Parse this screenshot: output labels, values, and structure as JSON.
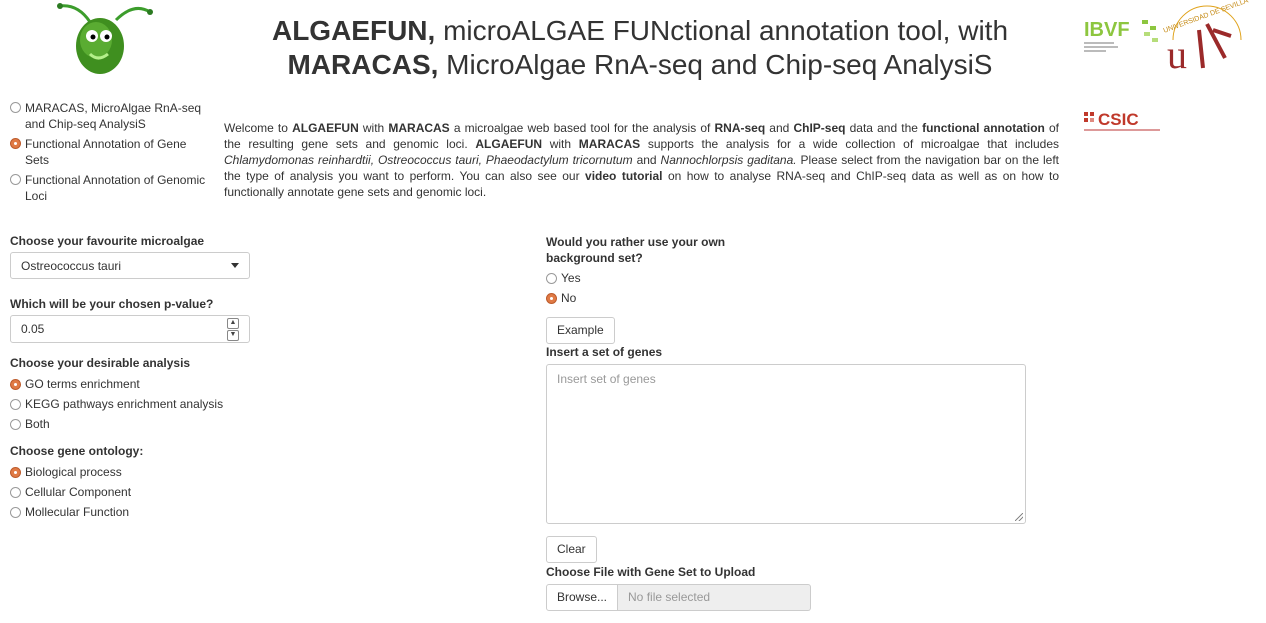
{
  "header": {
    "title_line1_bold": "ALGAEFUN,",
    "title_line1_rest": " microALGAE FUNctional annotation tool, with",
    "title_line2_bold": "MARACAS,",
    "title_line2_rest": " MicroAlgae RnA-seq and Chip-seq AnalysiS",
    "ibvf_logo": "IBVF",
    "us_logo": "UNIVERSIDAD DE SEVILLA",
    "csic_logo": "CSIC"
  },
  "nav": {
    "items": [
      {
        "label": "MARACAS, MicroAlgae RnA-seq and Chip-seq AnalysiS",
        "selected": false
      },
      {
        "label": "Functional Annotation of Gene Sets",
        "selected": true
      },
      {
        "label": "Functional Annotation of Genomic Loci",
        "selected": false
      }
    ]
  },
  "intro": {
    "p1": "Welcome to ",
    "algaefun": "ALGAEFUN",
    "p2": " with ",
    "maracas": "MARACAS",
    "p3": " a microalgae web based tool for the analysis of ",
    "rnaseq": "RNA-seq",
    "p4": " and ",
    "chipseq": "ChIP-seq",
    "p5": " data and the ",
    "funcann": "functional annotation",
    "p6": " of the resulting gene sets and genomic loci. ",
    "algaefun2": "ALGAEFUN",
    "p7": " with ",
    "maracas2": "MARACAS",
    "p8": " supports the analysis for a wide collection of microalgae that includes ",
    "sp1": "Chlamydomonas reinhardtii, Ostreococcus tauri, Phaeodactylum tricornutum",
    "p9": " and ",
    "sp2": "Nannochlorpsis gaditana.",
    "p10": " Please select from the navigation bar on the left the type of analysis you want to perform. You can also see our ",
    "video": "video tutorial",
    "p11": " on how to analyse RNA-seq and ChIP-seq data as well as on how to functionally annotate gene sets and genomic loci."
  },
  "form_left": {
    "microalgae_label": "Choose your favourite microalgae",
    "microalgae_value": "Ostreococcus tauri",
    "pvalue_label": "Which will be your chosen p-value?",
    "pvalue_value": "0.05",
    "analysis_label": "Choose your desirable analysis",
    "analysis_options": [
      {
        "label": "GO terms enrichment",
        "selected": true
      },
      {
        "label": "KEGG pathways enrichment analysis",
        "selected": false
      },
      {
        "label": "Both",
        "selected": false
      }
    ],
    "ontology_label": "Choose gene ontology:",
    "ontology_options": [
      {
        "label": "Biological process",
        "selected": true
      },
      {
        "label": "Cellular Component",
        "selected": false
      },
      {
        "label": "Mollecular Function",
        "selected": false
      }
    ]
  },
  "form_right": {
    "background_label": "Would you rather use your own background set?",
    "background_options": [
      {
        "label": "Yes",
        "selected": false
      },
      {
        "label": "No",
        "selected": true
      }
    ],
    "example_button": "Example",
    "genes_label": "Insert a set of genes",
    "genes_placeholder": "Insert set of genes",
    "clear_button": "Clear",
    "upload_label": "Choose File with Gene Set to Upload",
    "browse_button": "Browse...",
    "file_status": "No file selected"
  },
  "colors": {
    "radio_selected": "#e07a45",
    "ibvf_green": "#8dc63f",
    "us_red": "#9b2a2a",
    "csic_red": "#c0392b"
  }
}
